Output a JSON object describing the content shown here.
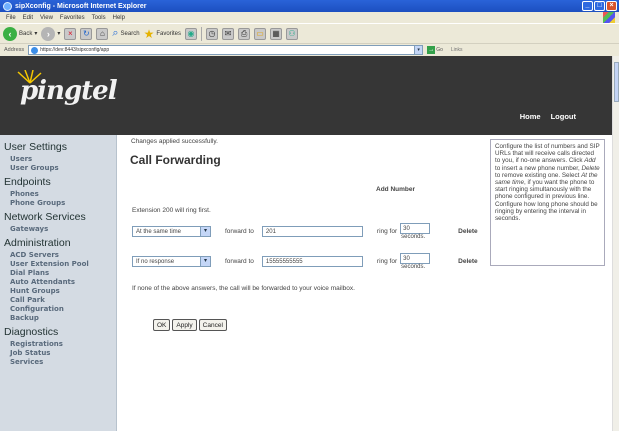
{
  "window": {
    "title": "sipXconfig - Microsoft Internet Explorer"
  },
  "menu": [
    "File",
    "Edit",
    "View",
    "Favorites",
    "Tools",
    "Help"
  ],
  "toolbar": {
    "back_label": "Back",
    "search_label": "Search",
    "favorites_label": "Favorites"
  },
  "address": {
    "label": "Address",
    "url": "https://dev:8443/sipxconfig/app",
    "go_label": "Go",
    "links_label": "Links"
  },
  "banner": {
    "logo_text": "pingtel",
    "home_link": "Home",
    "logout_link": "Logout"
  },
  "sidebar": {
    "sections": [
      {
        "heading": "User Settings",
        "items": [
          "Users",
          "User Groups"
        ]
      },
      {
        "heading": "Endpoints",
        "items": [
          "Phones",
          "Phone Groups"
        ]
      },
      {
        "heading": "Network Services",
        "items": [
          "Gateways"
        ]
      },
      {
        "heading": "Administration",
        "items": [
          "ACD Servers",
          "User Extension Pool",
          "Dial Plans",
          "Auto Attendants",
          "Hunt Groups",
          "Call Park",
          "Configuration",
          "Backup"
        ]
      },
      {
        "heading": "Diagnostics",
        "items": [
          "Registrations",
          "Job Status",
          "Services"
        ]
      }
    ]
  },
  "main": {
    "status_message": "Changes applied successfully.",
    "title": "Call Forwarding",
    "add_number": "Add Number",
    "extension_note": "Extension 200 will ring first.",
    "rows": [
      {
        "when": "At the same time",
        "forward_label": "forward to",
        "number": "201",
        "ring_label": "ring for",
        "seconds": "30",
        "seconds_label": "seconds.",
        "delete_label": "Delete"
      },
      {
        "when": "If no response",
        "forward_label": "forward to",
        "number": "15555555555",
        "ring_label": "ring for",
        "seconds": "30",
        "seconds_label": "seconds.",
        "delete_label": "Delete"
      }
    ],
    "fallback_text": "If none of the above answers, the call will be forwarded to your voice mailbox.",
    "buttons": {
      "ok": "OK",
      "apply": "Apply",
      "cancel": "Cancel"
    }
  },
  "help": {
    "part1": "Configure the list of numbers and SIP URLs that will receive calls directed to you, if no-one answers. Click ",
    "add_word": "Add",
    "part2": " to insert a new phone number, ",
    "delete_word": "Delete",
    "part3": " to remove existing one. Select ",
    "same_time_word": "At the same time",
    "part4": ", if you want the phone to start ringing simultanously with the phone configured in previous line. Configure how long phone should be ringing by entering the interval in seconds."
  },
  "colors": {
    "banner": "#363636",
    "sidebar": "#d4dbe3",
    "sidebar_link": "#596a7c",
    "titlebar": "#2a63d8"
  }
}
